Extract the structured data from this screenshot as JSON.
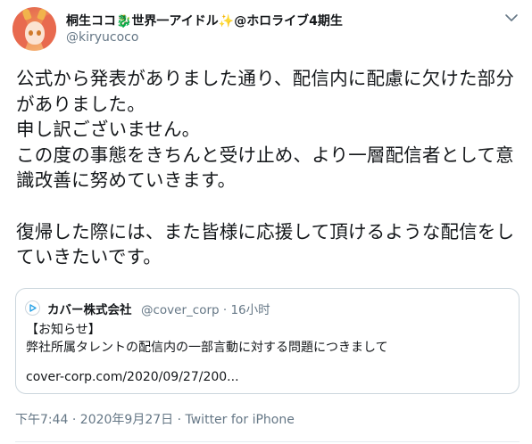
{
  "author": {
    "display_name": "桐生ココ",
    "name_emoji_dragon": "🐉",
    "name_suffix": "世界一アイドル",
    "name_emoji_sparkle": "✨",
    "name_group": "@ホロライブ4期生",
    "handle": "@kiryucoco",
    "avatar_icon": "avatar-image"
  },
  "tweet": {
    "text": "公式から発表がありました通り、配信内に配慮に欠けた部分がありました。\n申し訳ございません。\nこの度の事態をきちんと受け止め、より一層配信者として意識改善に努めていきます。\n\n復帰した際には、また皆様に応援して頂けるような配信をしていきたいです。"
  },
  "quote": {
    "account_name": "カバー株式会社",
    "handle_time": "@cover_corp · 16小时",
    "line1": "【お知らせ】",
    "line2": "弊社所属タレントの配信内の一部言動に対する問題につきまして",
    "link": "cover-corp.com/2020/09/27/200..."
  },
  "footer": {
    "time": "下午7:44 · 2020年9月27日",
    "separator": " · ",
    "source": "Twitter for iPhone"
  },
  "colors": {
    "text": "#14171a",
    "secondary": "#657786",
    "border": "#ccd6dd",
    "accent": "#1da1f2"
  }
}
